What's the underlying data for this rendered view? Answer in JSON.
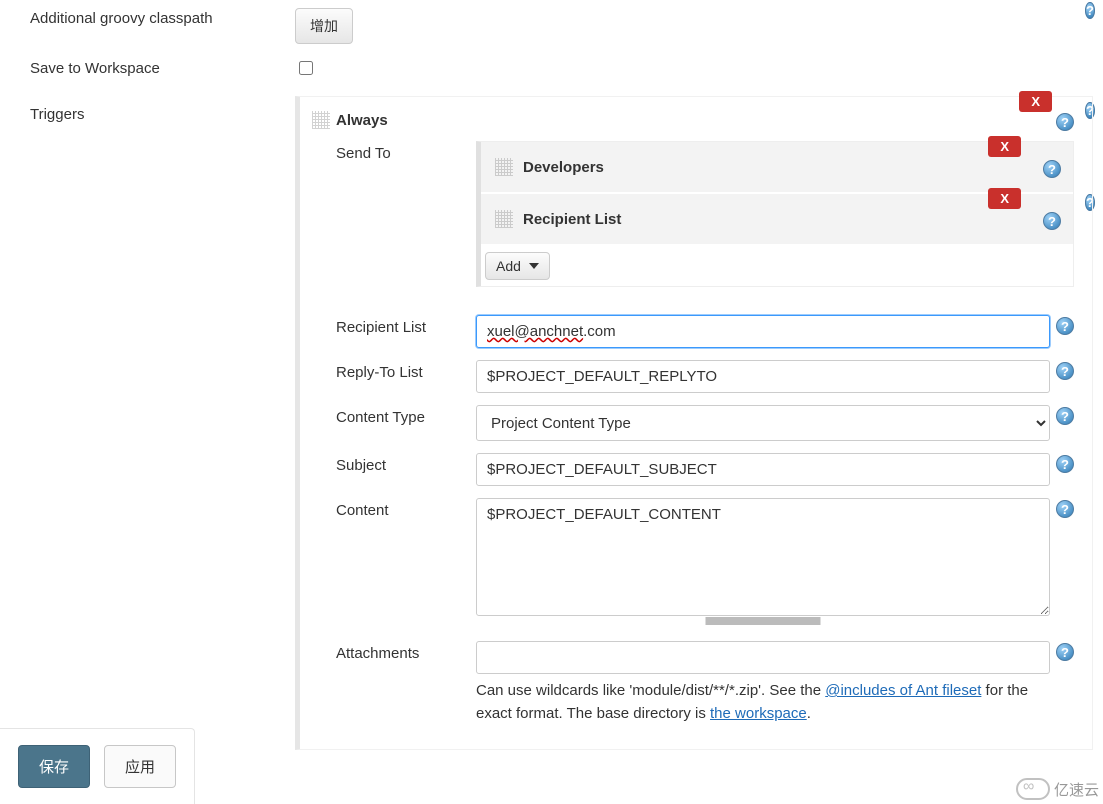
{
  "rows": {
    "classpath_label": "Additional groovy classpath",
    "classpath_add_btn": "增加",
    "save_ws_label": "Save to Workspace",
    "triggers_label": "Triggers"
  },
  "trigger": {
    "title": "Always",
    "close": "X",
    "sendto_label": "Send To",
    "sendto_items": [
      {
        "title": "Developers",
        "close": "X"
      },
      {
        "title": "Recipient List",
        "close": "X"
      }
    ],
    "add_label": "Add",
    "recipient_list_label": "Recipient List",
    "recipient_list_value_pre": "xuel@anchnet",
    "recipient_list_value_post": ".com",
    "replyto_label": "Reply-To List",
    "replyto_value": "$PROJECT_DEFAULT_REPLYTO",
    "content_type_label": "Content Type",
    "content_type_value": "Project Content Type",
    "subject_label": "Subject",
    "subject_value": "$PROJECT_DEFAULT_SUBJECT",
    "content_label": "Content",
    "content_value": "$PROJECT_DEFAULT_CONTENT",
    "attachments_label": "Attachments",
    "attachments_value": "",
    "attachments_help_pre": "Can use wildcards like 'module/dist/**/*.zip'. See the ",
    "attachments_help_link1": "@includes of Ant fileset",
    "attachments_help_mid": " for the exact format. The base directory is ",
    "attachments_help_link2": "the workspace",
    "attachments_help_end": "."
  },
  "action": {
    "save": "保存",
    "apply": "应用"
  },
  "watermark": "亿速云"
}
